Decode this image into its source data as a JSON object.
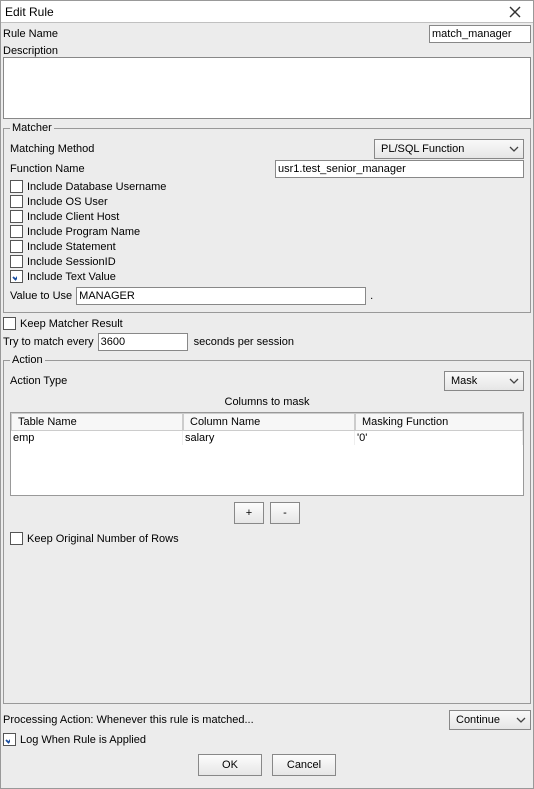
{
  "window": {
    "title": "Edit Rule"
  },
  "header": {
    "rule_name_label": "Rule Name",
    "rule_name_value": "match_manager",
    "description_label": "Description",
    "description_value": ""
  },
  "matcher": {
    "legend": "Matcher",
    "matching_method_label": "Matching Method",
    "matching_method_value": "PL/SQL Function",
    "function_name_label": "Function Name",
    "function_name_value": "usr1.test_senior_manager",
    "checks": {
      "include_db_username": {
        "label": "Include Database Username",
        "checked": false
      },
      "include_os_user": {
        "label": "Include OS User",
        "checked": false
      },
      "include_client_host": {
        "label": "Include Client Host",
        "checked": false
      },
      "include_program_name": {
        "label": "Include Program Name",
        "checked": false
      },
      "include_statement": {
        "label": "Include Statement",
        "checked": false
      },
      "include_sessionid": {
        "label": "Include SessionID",
        "checked": false
      },
      "include_text_value": {
        "label": "Include Text Value",
        "checked": true
      }
    },
    "value_to_use_label": "Value to Use",
    "value_to_use_value": "MANAGER",
    "value_to_use_suffix": "."
  },
  "keep_matcher_result": {
    "label": "Keep Matcher Result",
    "checked": false
  },
  "try_match": {
    "prefix": "Try to match every",
    "value": "3600",
    "suffix": "seconds per session"
  },
  "action": {
    "legend": "Action",
    "action_type_label": "Action Type",
    "action_type_value": "Mask",
    "columns_heading": "Columns to mask",
    "table": {
      "headers": {
        "tname": "Table Name",
        "cname": "Column Name",
        "mfunc": "Masking Function"
      },
      "rows": [
        {
          "tname": "emp",
          "cname": "salary",
          "mfunc": "'0'"
        }
      ]
    },
    "add_label": "+",
    "remove_label": "-",
    "keep_original_rows": {
      "label": "Keep Original Number of Rows",
      "checked": false
    }
  },
  "processing": {
    "label": "Processing Action: Whenever this rule is matched...",
    "value": "Continue"
  },
  "log_applied": {
    "label": "Log When Rule is Applied",
    "checked": true
  },
  "buttons": {
    "ok": "OK",
    "cancel": "Cancel"
  }
}
